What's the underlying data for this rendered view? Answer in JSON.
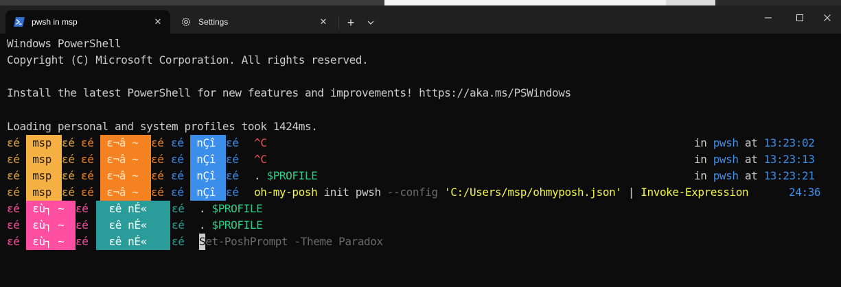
{
  "window": {
    "tabs": [
      {
        "label": "pwsh in msp",
        "icon": "powershell-icon",
        "active": true
      },
      {
        "label": "Settings",
        "icon": "gear-icon",
        "active": false
      }
    ],
    "new_tab": "+",
    "controls": [
      "minimize",
      "maximize",
      "close"
    ]
  },
  "terminal": {
    "header_lines": [
      "Windows PowerShell",
      "Copyright (C) Microsoft Corporation. All rights reserved.",
      "",
      "Install the latest PowerShell for new features and improvements! https://aka.ms/PSWindows",
      "",
      "Loading personal and system profiles took 1424ms."
    ],
    "prompt_style_1": {
      "lead": "εé",
      "user": " msp ",
      "sep1": "εé",
      "sep2": "εé",
      "folder": " ε¬â ~ ",
      "sep3": "εé",
      "sep4": "εé",
      "git": " nÇî ",
      "sep5": "εé",
      "sep6": "εé",
      "rows": [
        {
          "command": "^C",
          "cmd_color": "red",
          "shell": "pwsh",
          "time": "13:23:02"
        },
        {
          "command": "^C",
          "cmd_color": "red",
          "shell": "pwsh",
          "time": "13:23:13"
        },
        {
          "command_parts": [
            ". ",
            "$PROFILE"
          ],
          "shell": "pwsh",
          "time": "13:23:21"
        },
        {
          "command_parts": [
            "oh-my-posh",
            " init pwsh ",
            "--config ",
            "'C:/Users/msp/ohmyposh.json'",
            " | ",
            "Invoke-Expression"
          ],
          "time": "24:36"
        }
      ]
    },
    "prompt_style_2": {
      "lead": "εé",
      "user": " εù┐ ~ ",
      "sep1": "εé",
      "sep2": "εé",
      "folder": "  εê",
      "git": "nÉ«",
      "sep3": "εé",
      "rows": [
        {
          "command_parts": [
            ". ",
            "$PROFILE"
          ]
        },
        {
          "command_parts": [
            ". ",
            "$PROFILE"
          ]
        },
        {
          "typed": "S",
          "ghost": "et-PoshPrompt -Theme Paradox"
        }
      ]
    },
    "labels": {
      "in": "in",
      "at": "at"
    }
  },
  "colors": {
    "background": "#0c0c0c",
    "foreground": "#cccccc",
    "user_segment": "#f5b043",
    "folder_segment": "#f58220",
    "git_segment": "#3b8eea",
    "pink_segment": "#ff4fa3",
    "teal_segment": "#2a9d9a",
    "blue_text": "#3b8eea"
  }
}
